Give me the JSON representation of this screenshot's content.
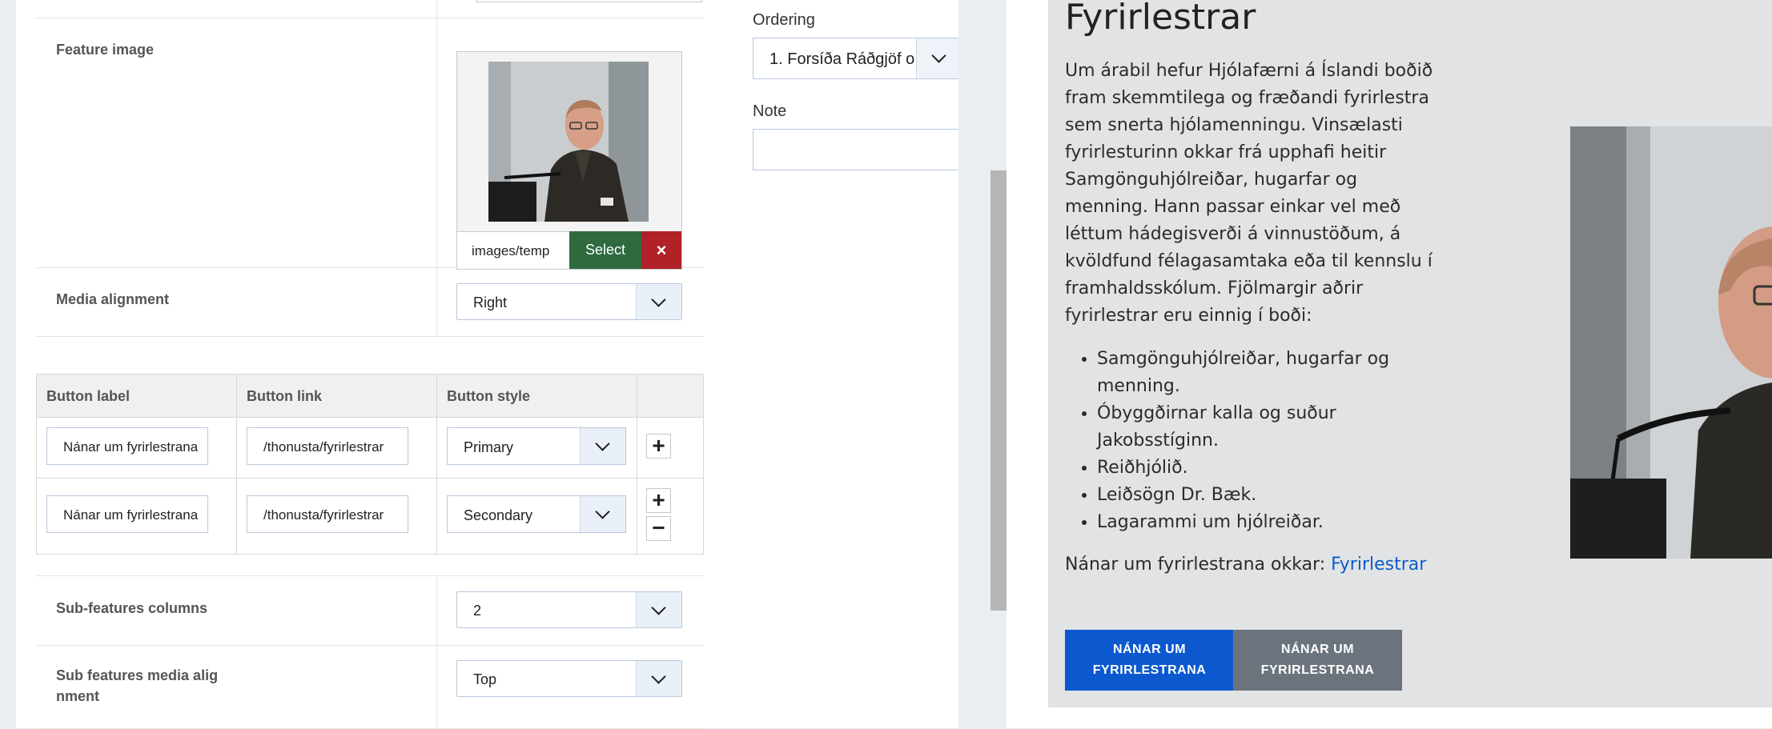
{
  "editor": {
    "feature_image": {
      "label": "Feature image",
      "path_value": "images/temp",
      "select_label": "Select",
      "clear_symbol": "×"
    },
    "media_alignment": {
      "label": "Media alignment",
      "value": "Right"
    },
    "buttons_table": {
      "headers": [
        "Button label",
        "Button link",
        "Button style"
      ],
      "rows": [
        {
          "label": "Nánar um fyrirlestrana",
          "link": "/thonusta/fyrirlestrar",
          "style": "Primary"
        },
        {
          "label": "Nánar um fyrirlestrana",
          "link": "/thonusta/fyrirlestrar",
          "style": "Secondary"
        }
      ],
      "add_symbol": "+",
      "remove_symbol": "−"
    },
    "sub_features_columns": {
      "label": "Sub-features columns",
      "value": "2"
    },
    "sub_features_media_alignment": {
      "label": "Sub features media alig nment",
      "value": "Top"
    }
  },
  "side": {
    "ordering_label": "Ordering",
    "ordering_value": "1. Forsíða Ráðgjöf o",
    "note_label": "Note",
    "note_value": ""
  },
  "preview": {
    "title": "Fyrirlestrar",
    "body": "Um árabil hefur Hjólafærni á Íslandi boðið fram skemmtilega og fræðandi fyrirlestra sem snerta hjólamenningu. Vinsælasti fyrirlesturinn okkar frá upphafi heitir Samgönguhjólreiðar, hugarfar og menning. Hann passar einkar vel með léttum hádegisverði á vinnustöðum, á kvöldfund félagasamtaka eða til kennslu í framhaldsskólum. Fjölmargir aðrir fyrirlestrar eru einnig í boði:",
    "list": [
      "Samgönguhjólreiðar, hugarfar og menning.",
      "Óbyggðirnar kalla og suður Jakobsstíginn.",
      "Reiðhjólið.",
      "Leiðsögn Dr. Bæk.",
      "Lagarammi um hjólreiðar."
    ],
    "more_text": "Nánar um fyrirlestrana okkar:",
    "more_link": "Fyrirlestrar",
    "button_primary": "NÁNAR UM FYRIRLESTRANA",
    "button_secondary": "NÁNAR UM FYRIRLESTRANA",
    "colors": {
      "primary": "#0c59cf",
      "secondary": "#6b747d",
      "link": "#0b5cc9"
    }
  }
}
